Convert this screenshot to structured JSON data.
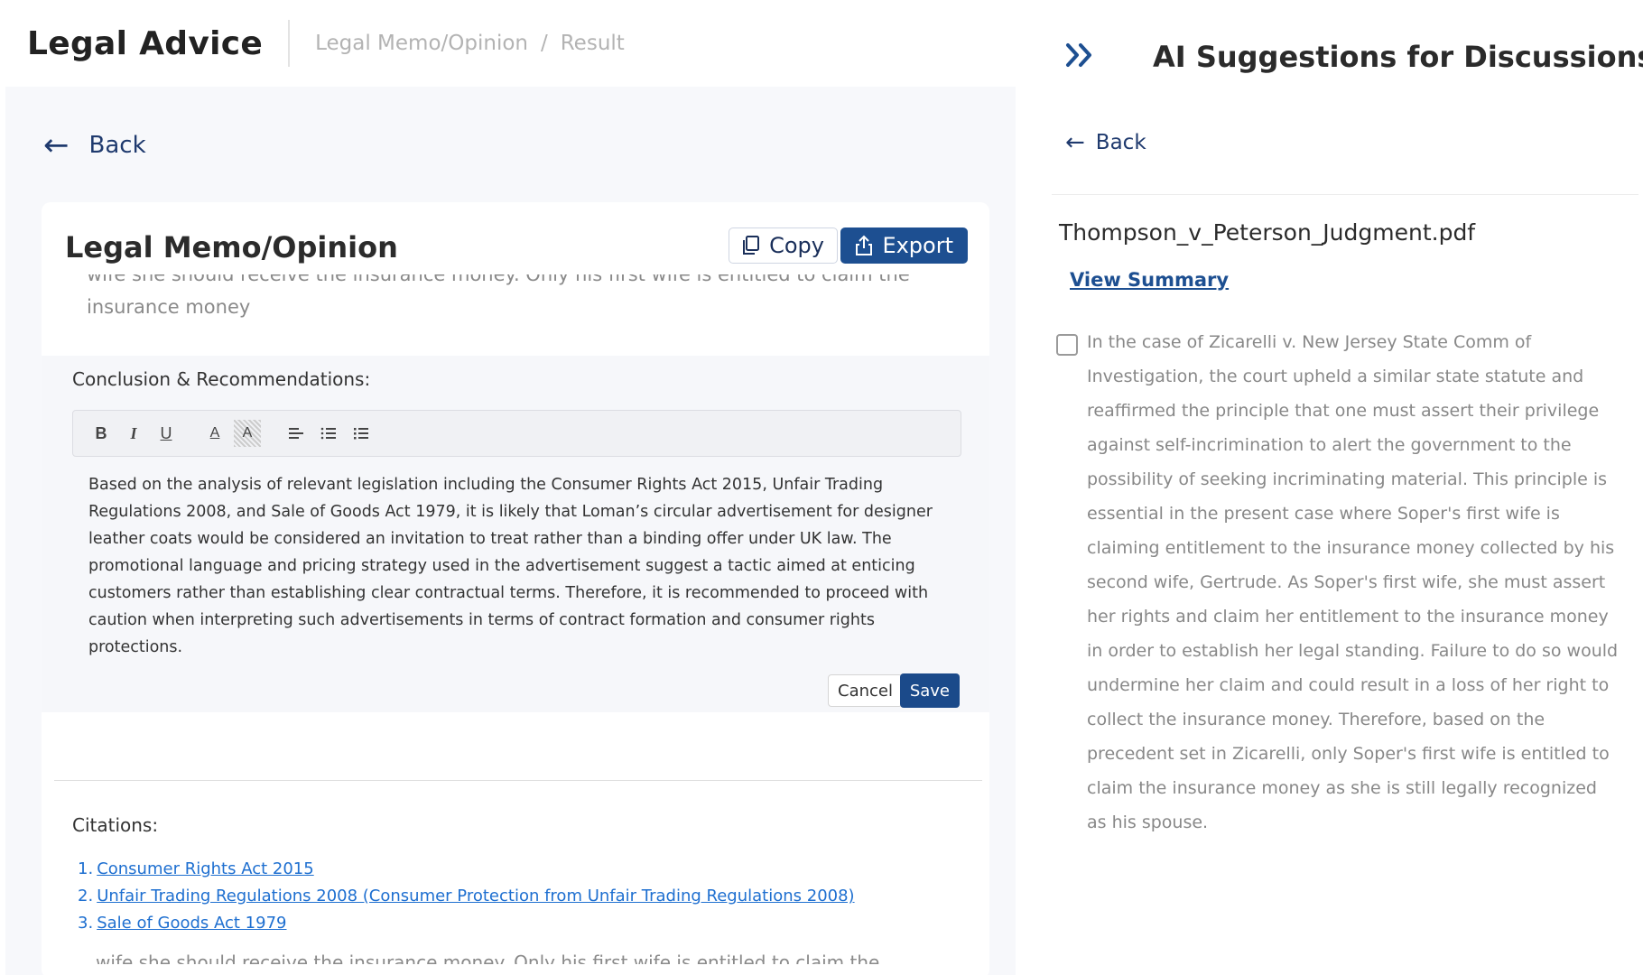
{
  "header": {
    "app_title": "Legal Advice",
    "breadcrumb": [
      "Legal Memo/Opinion",
      "/",
      "Result"
    ]
  },
  "left": {
    "back_label": "Back",
    "memo_title": "Legal Memo/Opinion",
    "copy_label": "Copy",
    "export_label": "Export",
    "clipped_line": "wife she should receive the insurance money. Only his first wife is entitled to claim the",
    "clipped_line2": "insurance money",
    "conclusion_label": "Conclusion & Recommendations:",
    "toolbar": {
      "bold": "B",
      "italic": "I",
      "underline": "U",
      "font_color": "A",
      "highlight": "A"
    },
    "conclusion_text": "Based on the analysis of relevant legislation including the Consumer Rights Act 2015, Unfair Trading Regulations 2008, and Sale of Goods Act 1979, it is likely that Loman’s circular advertisement for designer leather coats would be considered an invitation to treat rather than a binding offer under UK law. The promotional language and pricing strategy used in the advertisement suggest a tactic aimed at enticing customers rather than establishing clear contractual terms. Therefore, it is recommended to proceed with caution when interpreting such advertisements in terms of contract formation and consumer rights protections.",
    "cancel_label": "Cancel",
    "save_label": "Save",
    "citations_label": "Citations:",
    "citations": [
      {
        "num": "1.",
        "text": "Consumer Rights Act 2015"
      },
      {
        "num": "2.",
        "text": "Unfair Trading Regulations 2008 (Consumer Protection from Unfair Trading Regulations 2008)"
      },
      {
        "num": "3.",
        "text": "Sale of Goods Act 1979"
      }
    ],
    "cut_line": "wife she should receive the insurance money. Only his first wife is entitled to claim the"
  },
  "right": {
    "title": "AI Suggestions for Discussions",
    "back_label": "Back",
    "file_name": "Thompson_v_Peterson_Judgment.pdf",
    "view_summary": "View Summary",
    "suggestion_text": "In the case of Zicarelli v. New Jersey State Comm of Investigation, the court upheld a similar state statute and reaffirmed the principle that one must assert their privilege against self-incrimination to alert the government to the possibility of seeking incriminating material. This principle is essential in the present case where Soper's first wife is claiming entitlement to the insurance money collected by his second wife, Gertrude. As Soper's first wife, she must assert her rights and claim her entitlement to the insurance money in order to establish her legal standing. Failure to do so would undermine her claim and could result in a loss of her right to collect the insurance money. Therefore, based on the precedent set in Zicarelli, only Soper's first wife is entitled to claim the insurance money as she is still legally recognized as his spouse."
  },
  "colors": {
    "primary": "#1d4f91",
    "link": "#1e6fd0",
    "muted": "#888888"
  }
}
